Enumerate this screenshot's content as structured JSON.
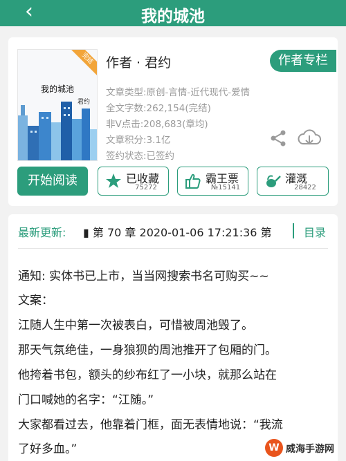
{
  "header": {
    "back_icon": "chevron-left-icon",
    "title": "我的城池"
  },
  "book": {
    "cover_title": "我的城池",
    "cover_author": "君约",
    "cover_badge": "完结",
    "author_line": "作者 · 君约",
    "column_button": "作者专栏",
    "meta": [
      "文章类型:原创-言情-近代现代-爱情",
      "全文字数:262,154(完结)",
      "非V点击:208,683(章均)",
      "文章积分:3.1亿",
      "签约状态:已签约"
    ],
    "share_icon": "share-icon",
    "download_icon": "cloud-download-icon"
  },
  "actions": {
    "read_button": "开始阅读",
    "collect": {
      "label": "已收藏",
      "count": "75272",
      "icon": "star-icon"
    },
    "bawang": {
      "label": "霸王票",
      "count": "№15141",
      "icon": "thumbs-up-icon"
    },
    "irrigate": {
      "label": "灌溉",
      "count": "28422",
      "icon": "watering-can-icon"
    }
  },
  "latest": {
    "label": "最新更新:",
    "text": "▮ 第 70 章 2020-01-06 17:21:36  第",
    "catalog_link": "目录"
  },
  "text_lines": [
    "通知:  实体书已上市，当当网搜索书名可购买~~",
    "文案：",
    "江随人生中第一次被表白，可惜被周池毁了。",
    "那天气氛绝佳，一身狼狈的周池推开了包厢的门。",
    "他挎着书包，额头的纱布红了一小块，就那么站在",
    "门口喊她的名字：“江随。”",
    "大家都看过去，他靠着门框，面无表情地说：“我流",
    "了好多血。”"
  ],
  "watermark": {
    "logo": "W",
    "text": "威海手游网"
  },
  "colors": {
    "accent": "#2c9d7c",
    "meta_text": "#9a9a9a",
    "badge": "#f2a53a"
  }
}
